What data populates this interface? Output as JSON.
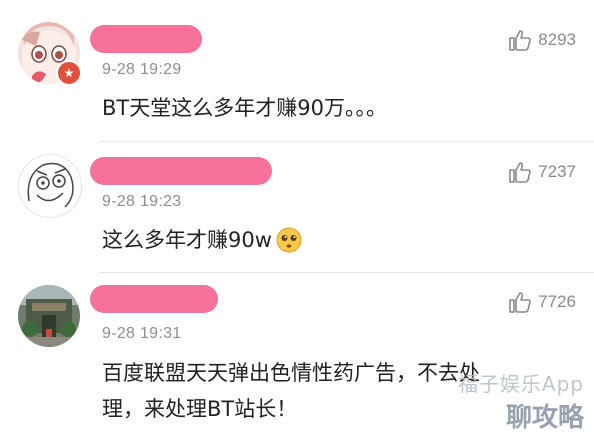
{
  "comments": [
    {
      "time": "9-28 19:29",
      "likes": "8293",
      "text": "BT天堂这么多年才赚90万。。。"
    },
    {
      "time": "9-28 19:23",
      "likes": "7237",
      "text": "这么多年才赚90w"
    },
    {
      "time": "9-28 19:31",
      "likes": "7726",
      "text_line1": "百度联盟天天弹出色情性药广告，不去处",
      "text_line2": "理，来处理BT站长！"
    }
  ],
  "watermark": {
    "line1": "福子娱乐App",
    "line2": "聊攻略"
  },
  "colors": {
    "redaction": "#f7729a",
    "meta_gray": "#8e8e8e",
    "text": "#222222"
  }
}
